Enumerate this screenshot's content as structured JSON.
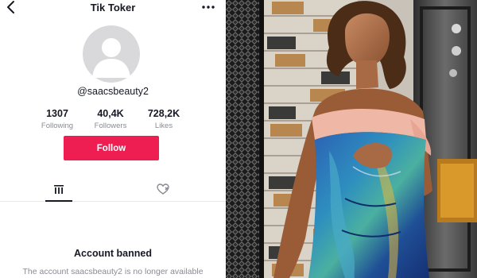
{
  "header": {
    "title": "Tik Toker",
    "back_icon": "chevron-left-icon",
    "more_icon": "ellipsis-icon"
  },
  "profile": {
    "username": "@saacsbeauty2",
    "avatar_icon": "default-avatar-icon"
  },
  "stats": [
    {
      "value": "1307",
      "label": "Following"
    },
    {
      "value": "40,4K",
      "label": "Followers"
    },
    {
      "value": "728,2K",
      "label": "Likes"
    }
  ],
  "actions": {
    "follow_label": "Follow",
    "follow_color": "#ee1d52"
  },
  "tabs": [
    {
      "icon": "videos-grid-icon",
      "active": true
    },
    {
      "icon": "liked-heart-icon",
      "active": false
    }
  ],
  "status": {
    "title": "Account banned",
    "message": "The account saacsbeauty2 is no longer available"
  },
  "photo": {
    "subject": "woman-portrait-photo"
  }
}
